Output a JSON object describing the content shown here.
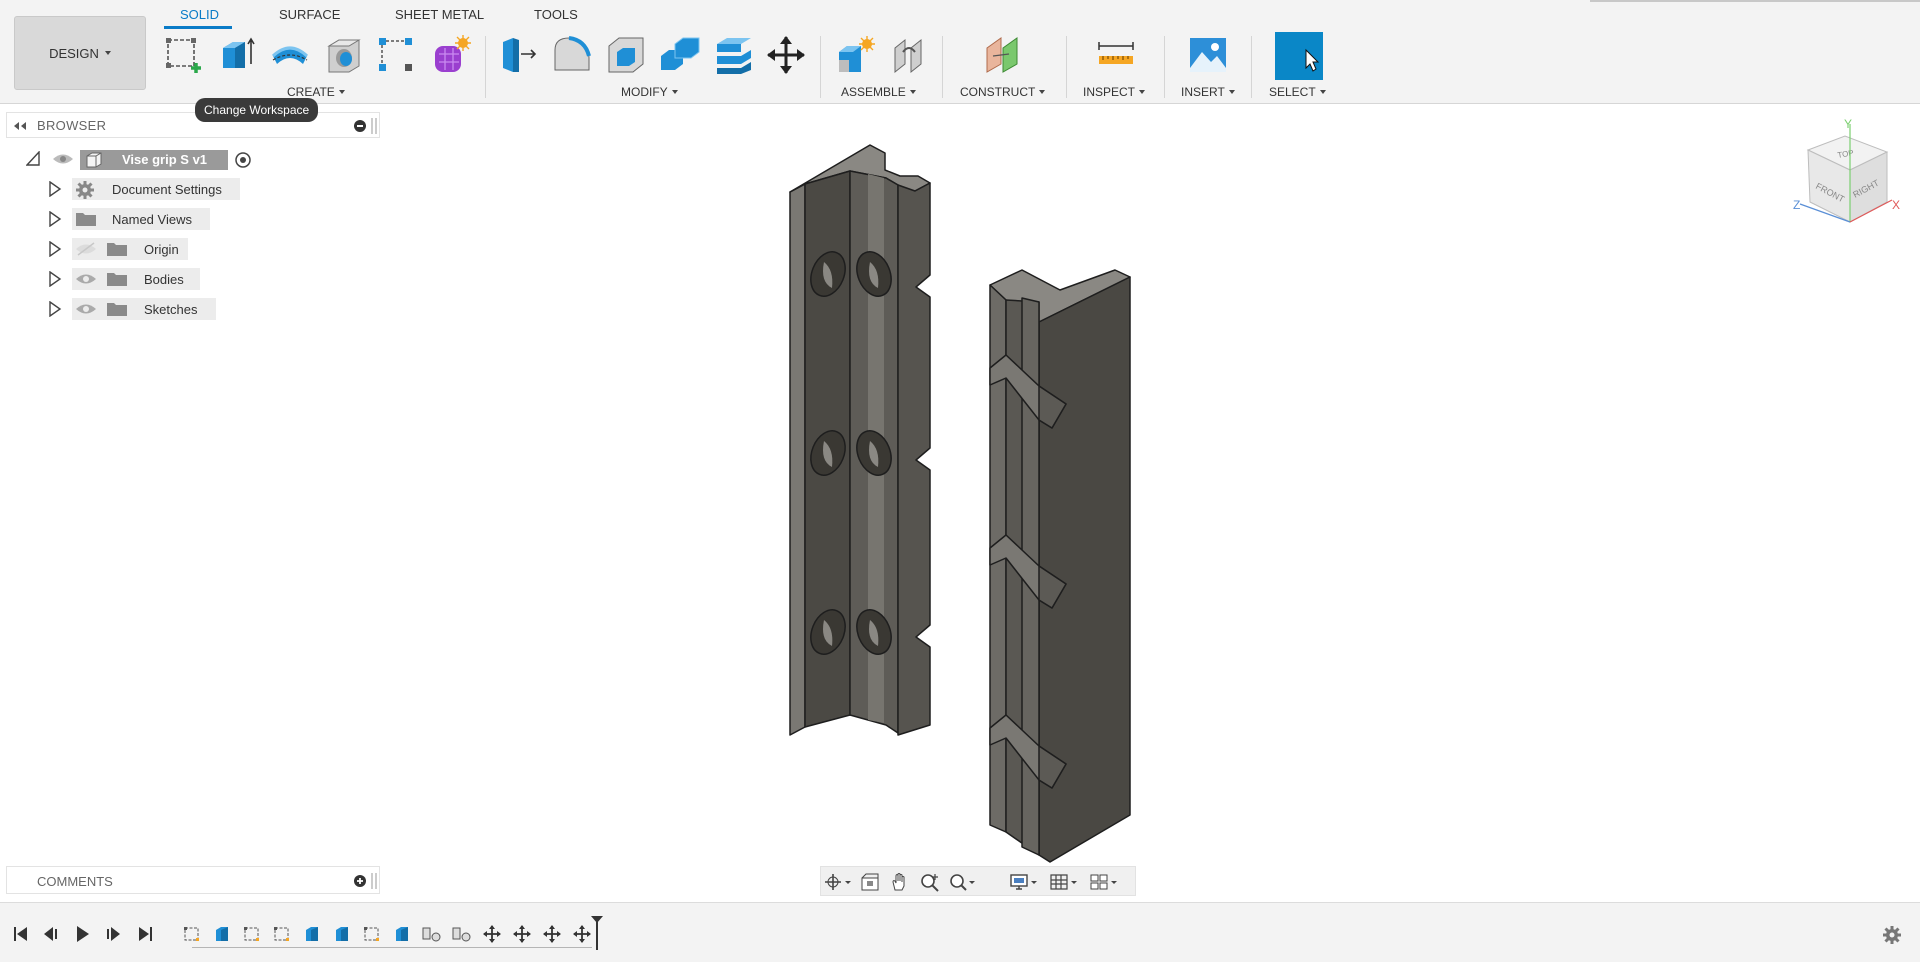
{
  "workspace": {
    "design_label": "DESIGN",
    "tooltip": "Change Workspace"
  },
  "tabs": [
    {
      "label": "SOLID",
      "active": true
    },
    {
      "label": "SURFACE",
      "active": false
    },
    {
      "label": "SHEET METAL",
      "active": false
    },
    {
      "label": "TOOLS",
      "active": false
    }
  ],
  "groups": {
    "create": "CREATE",
    "modify": "MODIFY",
    "assemble": "ASSEMBLE",
    "construct": "CONSTRUCT",
    "inspect": "INSPECT",
    "insert": "INSERT",
    "select": "SELECT"
  },
  "icons": {
    "create": [
      "create-sketch-icon",
      "extrude-icon",
      "revolve-icon",
      "hole-icon",
      "pattern-icon",
      "create-form-icon"
    ],
    "modify": [
      "press-pull-icon",
      "fillet-icon",
      "shell-icon",
      "combine-icon",
      "split-body-icon",
      "move-icon"
    ],
    "assemble": [
      "new-component-icon",
      "joint-icon"
    ],
    "construct": [
      "offset-plane-icon"
    ],
    "inspect": [
      "measure-icon"
    ],
    "insert": [
      "insert-image-icon"
    ],
    "select": [
      "select-icon"
    ]
  },
  "browser": {
    "title": "BROWSER",
    "root": "Vise grip S v1",
    "items": [
      {
        "label": "Document Settings",
        "icon": "gear-icon"
      },
      {
        "label": "Named Views",
        "icon": "folder-icon"
      },
      {
        "label": "Origin",
        "icon": "folder-icon",
        "visibility": "hidden"
      },
      {
        "label": "Bodies",
        "icon": "folder-icon",
        "visibility": "visible"
      },
      {
        "label": "Sketches",
        "icon": "folder-icon",
        "visibility": "visible"
      }
    ]
  },
  "comments": {
    "title": "COMMENTS"
  },
  "viewcube": {
    "faces": [
      "TOP",
      "FRONT",
      "RIGHT"
    ],
    "axes": [
      "Y",
      "Z",
      "X"
    ]
  },
  "navbar": [
    "orbit-icon",
    "look-at-icon",
    "pan-icon",
    "zoom-icon",
    "zoom-window-icon",
    "display-settings-icon",
    "grid-icon",
    "viewports-icon"
  ],
  "timeline": {
    "controls": [
      "first-icon",
      "previous-icon",
      "play-icon",
      "next-icon",
      "last-icon"
    ],
    "features": [
      "sketch",
      "extrude",
      "sketch",
      "sketch",
      "extrude",
      "extrude",
      "sketch",
      "extrude",
      "joint",
      "joint",
      "move",
      "move",
      "move",
      "move"
    ]
  },
  "colors": {
    "accent": "#0a7bc7",
    "body_dark": "#4c4a45",
    "body_mid": "#6a6862",
    "body_light": "#8a8883"
  }
}
